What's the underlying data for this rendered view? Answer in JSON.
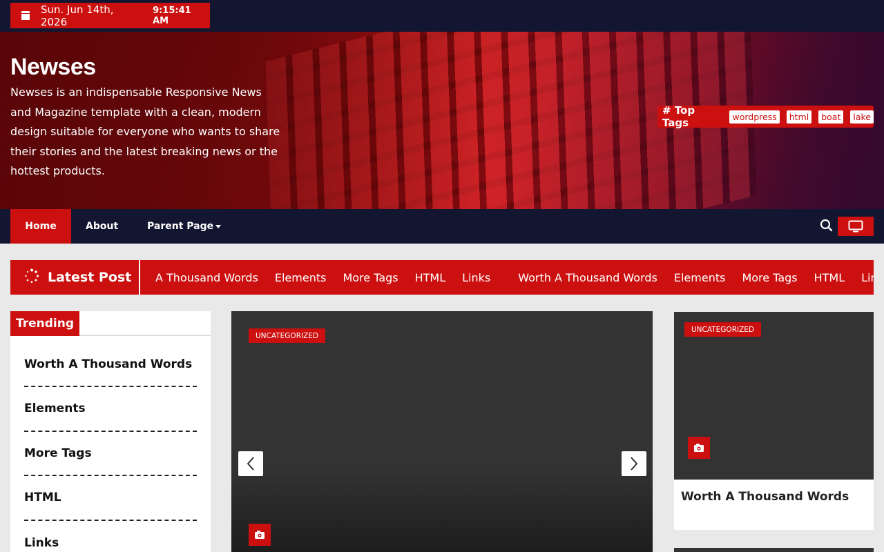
{
  "topbar": {
    "date": "Sun. Jun 14th, 2026",
    "time": "9:15:41 AM"
  },
  "header": {
    "site_title": "Newses",
    "site_description": "Newses is an indispensable Responsive News and Magazine template with a clean, modern design suitable for everyone who wants to share their stories and the latest breaking news or the hottest products.",
    "top_tags_label": "# Top Tags",
    "tags": [
      "wordpress",
      "html",
      "boat",
      "lake"
    ]
  },
  "nav": {
    "items": [
      "Home",
      "About",
      "Parent Page"
    ],
    "active": "Home"
  },
  "ticker": {
    "label": "Latest Post",
    "items": [
      "A Thousand Words",
      "Elements",
      "More Tags",
      "HTML",
      "Links",
      "Worth A Thousand Words",
      "Elements",
      "More Tags",
      "HTML",
      "Links"
    ]
  },
  "trending": {
    "label": "Trending",
    "items": [
      "Worth A Thousand Words",
      "Elements",
      "More Tags",
      "HTML",
      "Links"
    ]
  },
  "slider": {
    "category": "UNCATEGORIZED"
  },
  "side_card": {
    "category": "UNCATEGORIZED",
    "title": "Worth A Thousand Words"
  },
  "colors": {
    "accent": "#cc0f0f",
    "dark": "#131630",
    "page_bg": "#e9e9e9"
  }
}
